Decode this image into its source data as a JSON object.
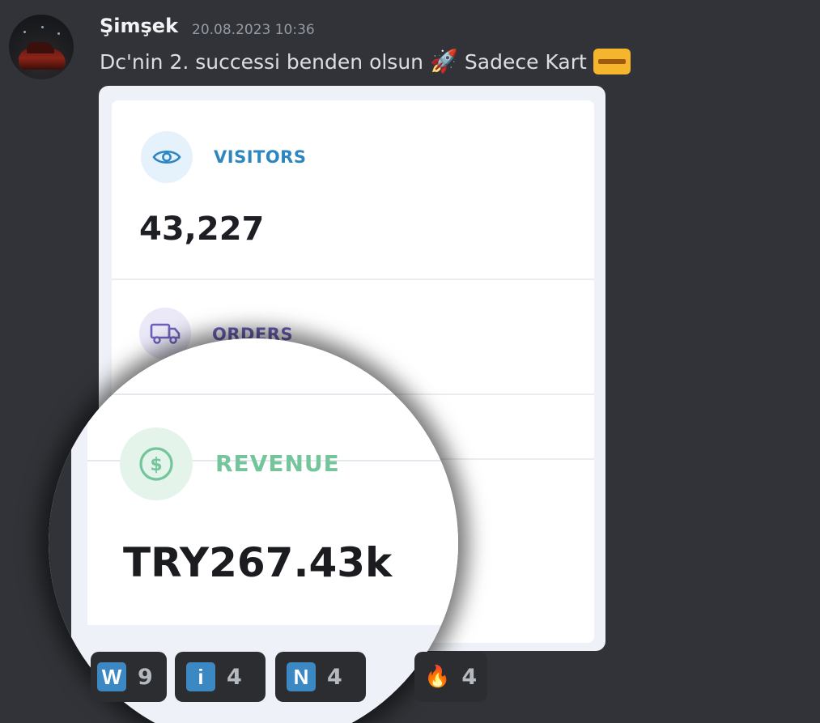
{
  "message": {
    "author": "Şimşek",
    "timestamp": "20.08.2023 10:36",
    "text_before": "Dc'nin 2. successi benden olsun",
    "rocket_emoji": "🚀",
    "text_after": "Sadece Kart",
    "icons": {
      "avatar": "avatar",
      "rocket": "rocket-emoji",
      "card": "credit-card-emoji"
    }
  },
  "stats": {
    "visitors": {
      "label": "VISITORS",
      "value": "43,227",
      "color": "#2e86c1"
    },
    "orders": {
      "label": "ORDERS",
      "color": "#6b61b8"
    },
    "revenue": {
      "label": "REVENUE",
      "value": "TRY267.43k",
      "color": "#74c59b"
    }
  },
  "reactions": [
    {
      "emoji": "W",
      "count": "9",
      "icon": "regional-indicator-w"
    },
    {
      "emoji": "i",
      "count": "4",
      "icon": "information-emoji"
    },
    {
      "emoji": "N",
      "count": "4",
      "icon": "regional-indicator-n"
    },
    {
      "emoji": "🔥",
      "count": "4",
      "icon": "fire-emoji"
    }
  ],
  "colors": {
    "background": "#313338",
    "reaction_bg": "#2b2d31",
    "reaction_key": "#3b88c3"
  }
}
